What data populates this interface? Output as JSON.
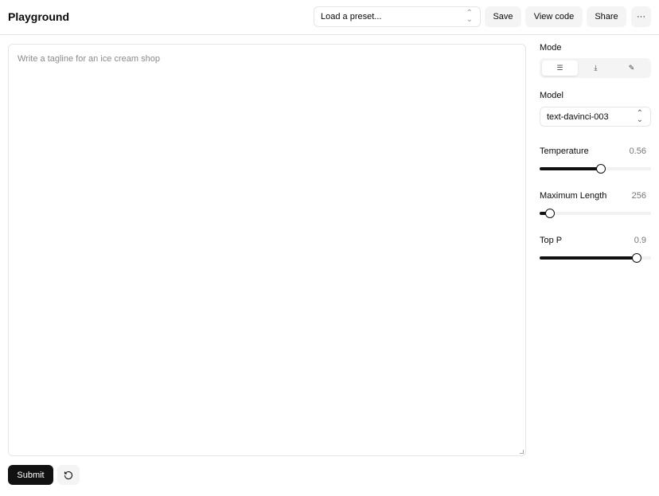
{
  "header": {
    "title": "Playground",
    "preset_placeholder": "Load a preset...",
    "save": "Save",
    "view_code": "View code",
    "share": "Share",
    "more": "···"
  },
  "editor": {
    "placeholder": "Write a tagline for an ice cream shop"
  },
  "actions": {
    "submit": "Submit"
  },
  "sidebar": {
    "mode_label": "Mode",
    "modes": [
      {
        "name": "complete",
        "active": true
      },
      {
        "name": "insert",
        "active": false
      },
      {
        "name": "edit",
        "active": false
      }
    ],
    "model_label": "Model",
    "model_value": "text-davinci-003",
    "temperature": {
      "label": "Temperature",
      "value": "0.56",
      "percent": 55
    },
    "max_length": {
      "label": "Maximum Length",
      "value": "256",
      "percent": 9
    },
    "top_p": {
      "label": "Top P",
      "value": "0.9",
      "percent": 87
    }
  }
}
